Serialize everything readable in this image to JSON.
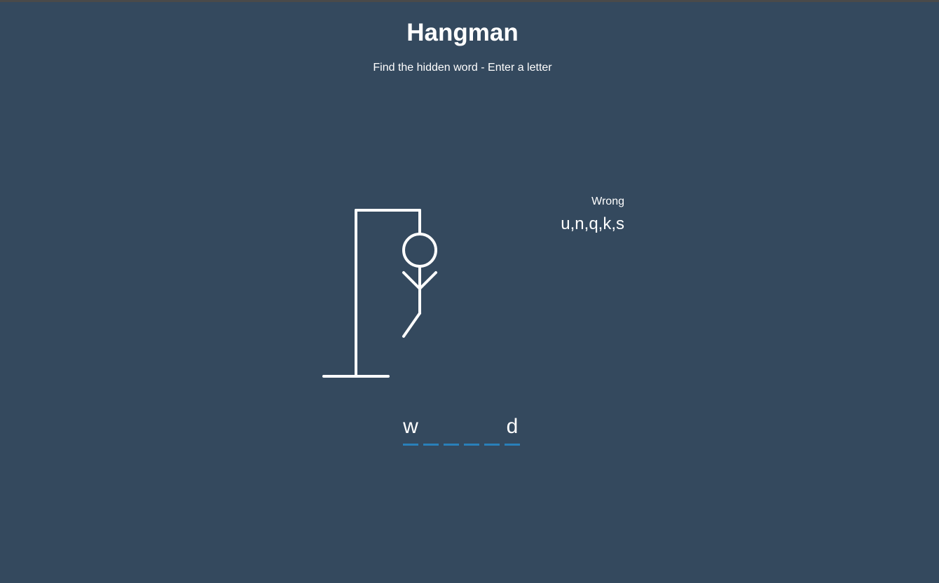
{
  "header": {
    "title": "Hangman",
    "subtitle": "Find the hidden word - Enter a letter"
  },
  "wrong": {
    "label": "Wrong",
    "letters": "u,n,q,k,s"
  },
  "word": {
    "slots": [
      "w",
      "",
      "",
      "",
      "",
      "d"
    ]
  },
  "figure": {
    "parts_shown": [
      "head",
      "body",
      "left-arm",
      "right-arm",
      "left-leg"
    ],
    "wrong_count": 5,
    "stroke_color": "#ffffff"
  },
  "colors": {
    "background": "#34495e",
    "text": "#ffffff",
    "underline": "#2980b9"
  }
}
